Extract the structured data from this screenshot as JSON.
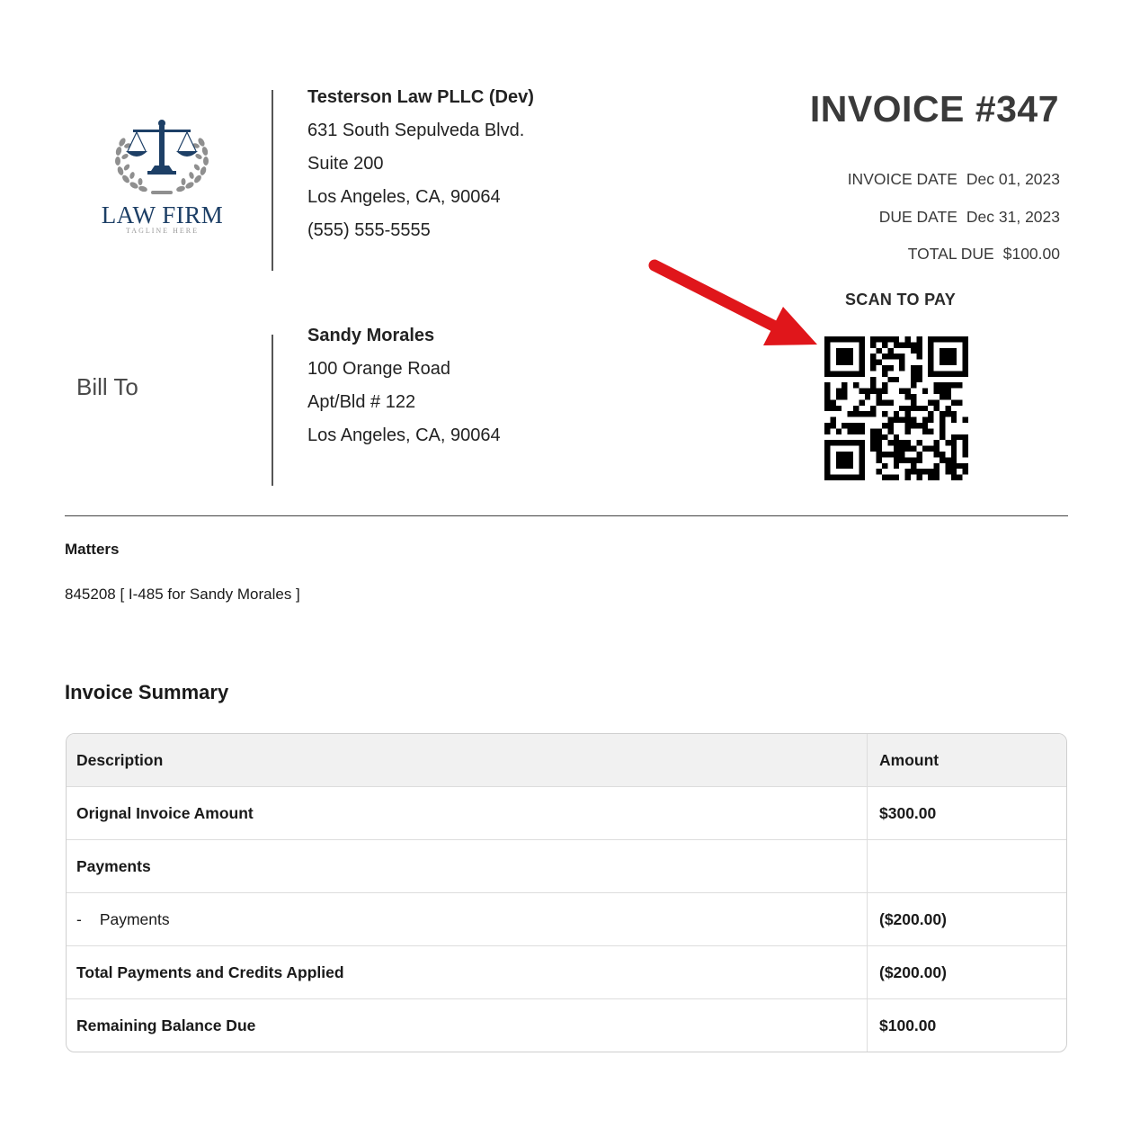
{
  "logo": {
    "name": "LAW FIRM",
    "tagline": "TAGLINE HERE",
    "brand_color": "#1d3f66"
  },
  "firm": {
    "name": "Testerson Law PLLC (Dev)",
    "address_line1": "631 South Sepulveda Blvd.",
    "address_line2": "Suite 200",
    "city_line": "Los Angeles, CA, 90064",
    "phone": "(555) 555-5555"
  },
  "invoice": {
    "title": "INVOICE #347",
    "date_label": "INVOICE DATE",
    "date_value": "Dec 01, 2023",
    "due_label": "DUE DATE",
    "due_value": "Dec 31, 2023",
    "total_label": "TOTAL DUE",
    "total_value": "$100.00",
    "scan_label": "SCAN TO PAY"
  },
  "bill_to": {
    "heading": "Bill To",
    "name": "Sandy Morales",
    "address_line1": "100 Orange Road",
    "address_line2": "Apt/Bld # 122",
    "city_line": "Los Angeles, CA, 90064"
  },
  "matters": {
    "heading": "Matters",
    "value": "845208 [ I-485 for Sandy Morales ]"
  },
  "summary": {
    "heading": "Invoice Summary",
    "columns": [
      "Description",
      "Amount"
    ],
    "rows": [
      {
        "description": "Orignal Invoice Amount",
        "amount": "$300.00"
      },
      {
        "description": "Payments",
        "amount": ""
      },
      {
        "dash": "-",
        "description": "Payments",
        "amount": "($200.00)"
      },
      {
        "description": "Total Payments and Credits Applied",
        "amount": "($200.00)"
      },
      {
        "description": "Remaining Balance Due",
        "amount": "$100.00"
      }
    ]
  },
  "annotation": {
    "arrow_color": "#e0161b"
  }
}
